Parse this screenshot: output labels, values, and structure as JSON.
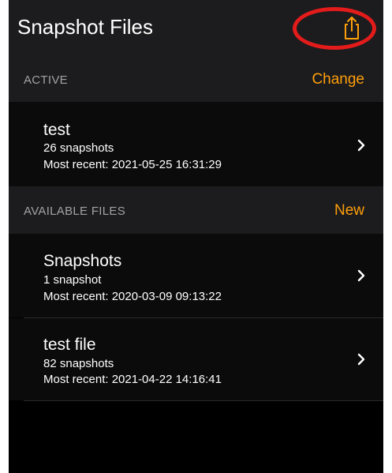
{
  "nav": {
    "title": "Snapshot Files",
    "share_icon": "share-icon"
  },
  "active_section": {
    "header": "ACTIVE",
    "action": "Change",
    "items": [
      {
        "name": "test",
        "count": "26 snapshots",
        "recent": "Most recent: 2021-05-25 16:31:29"
      }
    ]
  },
  "available_section": {
    "header": "AVAILABLE FILES",
    "action": "New",
    "items": [
      {
        "name": "Snapshots",
        "count": "1 snapshot",
        "recent": "Most recent: 2020-03-09 09:13:22"
      },
      {
        "name": "test file",
        "count": "82 snapshots",
        "recent": "Most recent: 2021-04-22 14:16:41"
      }
    ]
  },
  "colors": {
    "accent": "#ff9f0a",
    "highlight": "#e31b1b",
    "background": "#000000",
    "header_bg": "#1c1c1e"
  }
}
